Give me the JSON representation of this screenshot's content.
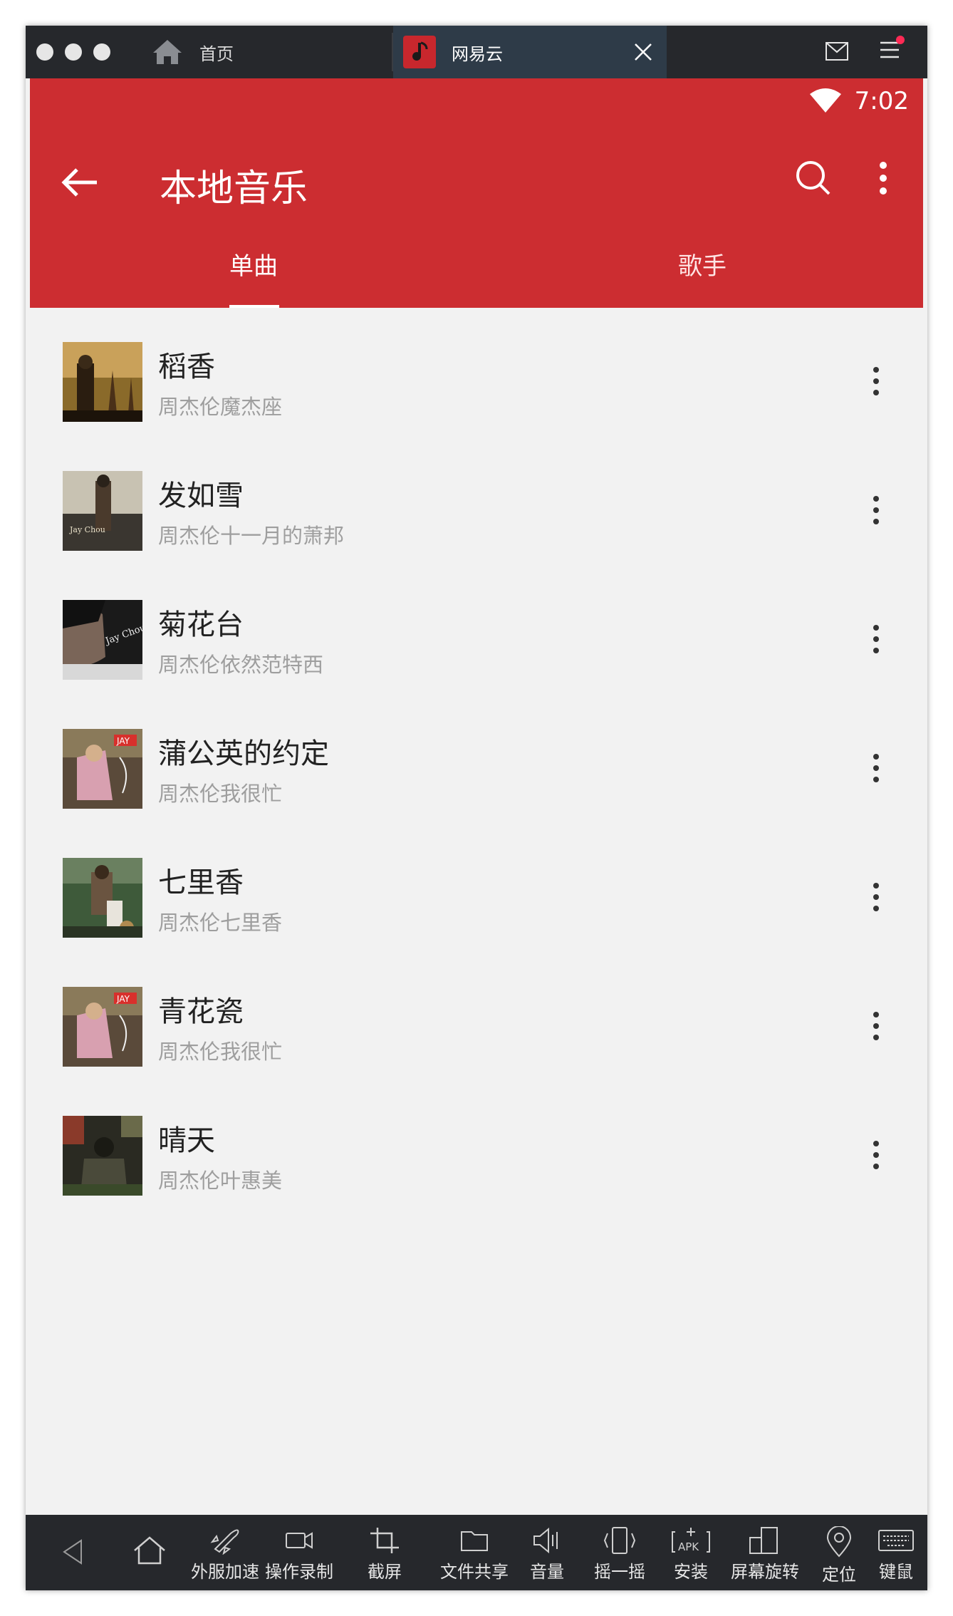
{
  "titlebar": {
    "home_tab_label": "首页",
    "active_tab_label": "网易云"
  },
  "status": {
    "time": "7:02"
  },
  "header": {
    "title": "本地音乐",
    "tabs": [
      {
        "label": "单曲",
        "active": true
      },
      {
        "label": "歌手",
        "active": false
      }
    ]
  },
  "songs": [
    {
      "title": "稻香",
      "subtitle": "周杰伦魔杰座"
    },
    {
      "title": "发如雪",
      "subtitle": "周杰伦十一月的萧邦"
    },
    {
      "title": "菊花台",
      "subtitle": "周杰伦依然范特西"
    },
    {
      "title": "蒲公英的约定",
      "subtitle": "周杰伦我很忙"
    },
    {
      "title": "七里香",
      "subtitle": "周杰伦七里香"
    },
    {
      "title": "青花瓷",
      "subtitle": "周杰伦我很忙"
    },
    {
      "title": "晴天",
      "subtitle": "周杰伦叶惠美"
    }
  ],
  "toolbar": {
    "items": [
      "外服加速",
      "操作录制",
      "截屏",
      "文件共享",
      "音量",
      "摇一摇",
      "安装",
      "屏幕旋转",
      "定位",
      "键鼠"
    ]
  },
  "colors": {
    "brand_red": "#cc2d31",
    "titlebar": "#26282c",
    "active_tab": "#2e3b48",
    "list_bg": "#f2f2f2",
    "subtitle_gray": "#9e9e9e"
  }
}
